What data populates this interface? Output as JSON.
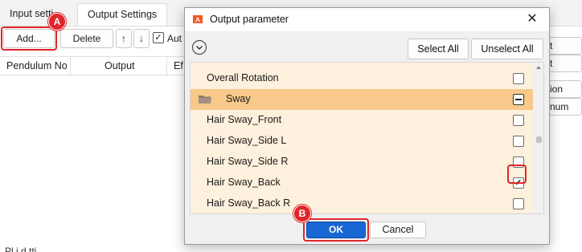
{
  "background": {
    "tabs": [
      {
        "label": "Input setti"
      },
      {
        "label": "Output Settings"
      }
    ],
    "toolbar": {
      "add_label": "Add...",
      "delete_label": "Delete",
      "up_label": "↑",
      "down_label": "↓",
      "auto_label": "Aut"
    },
    "table": {
      "columns": [
        "Pendulum No",
        "Output",
        "Ef"
      ]
    },
    "right_buttons": [
      "t",
      "t",
      "ion",
      "num"
    ],
    "bottom_text": "Pl     i       d  tti"
  },
  "dialog": {
    "title": "Output parameter",
    "select_all_label": "Select All",
    "unselect_all_label": "Unselect All",
    "rows": [
      {
        "label": "Overall Rotation",
        "type": "item",
        "state": "unchecked"
      },
      {
        "label": "Sway",
        "type": "group",
        "state": "partial"
      },
      {
        "label": "Hair Sway_Front",
        "type": "item",
        "state": "unchecked"
      },
      {
        "label": "Hair Sway_Side L",
        "type": "item",
        "state": "unchecked"
      },
      {
        "label": "Hair Sway_Side R",
        "type": "item",
        "state": "unchecked"
      },
      {
        "label": "Hair Sway_Back",
        "type": "item",
        "state": "checked"
      },
      {
        "label": "Hair Sway_Back R",
        "type": "item",
        "state": "unchecked"
      }
    ],
    "ok_label": "OK",
    "cancel_label": "Cancel"
  },
  "annotations": {
    "marker_a": "A",
    "marker_b": "B",
    "highlight_color": "#e0262b"
  },
  "colors": {
    "list_bg": "#fdf0dc",
    "group_row_bg": "#f8c98a",
    "ok_button": "#1967d2"
  }
}
